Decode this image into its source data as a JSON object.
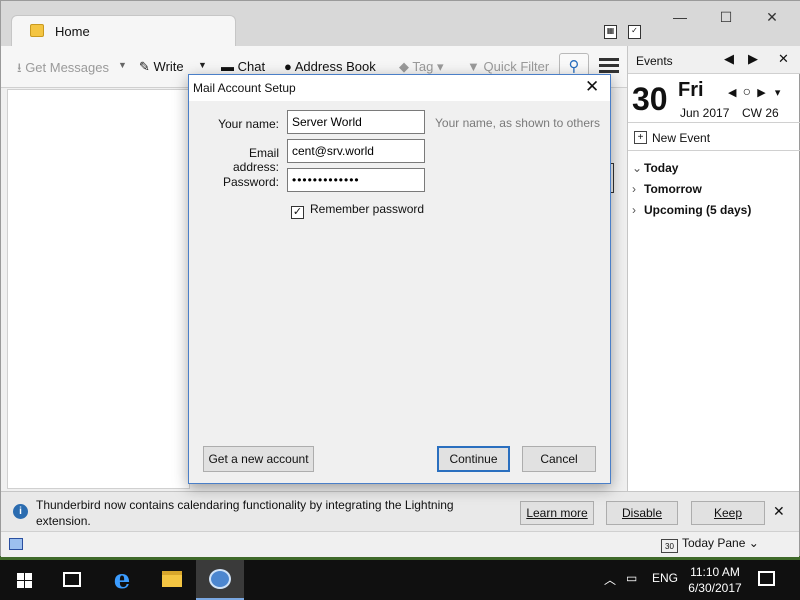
{
  "window": {
    "tab_title": "Home"
  },
  "toolbar": {
    "get_messages": "Get Messages",
    "write": "Write",
    "chat": "Chat",
    "address_book": "Address Book",
    "tag": "Tag",
    "quick_filter": "Quick Filter"
  },
  "events": {
    "title": "Events",
    "day_number": "30",
    "weekday": "Fri",
    "month_year": "Jun 2017",
    "calendar_week": "CW 26",
    "new_event": "New Event",
    "agenda": [
      {
        "label": "Today",
        "expanded": true
      },
      {
        "label": "Tomorrow",
        "expanded": false
      },
      {
        "label": "Upcoming (5 days)",
        "expanded": false
      }
    ]
  },
  "dialog": {
    "title": "Mail Account Setup",
    "name_label": "Your name:",
    "name_value": "Server World",
    "name_hint": "Your name, as shown to others",
    "email_label": "Email address:",
    "email_value": "cent@srv.world",
    "password_label": "Password:",
    "password_value": "•••••••••••••",
    "remember_label": "Remember password",
    "remember_checked": true,
    "get_new_account": "Get a new account",
    "continue": "Continue",
    "cancel": "Cancel"
  },
  "notification": {
    "message": "Thunderbird now contains calendaring functionality by integrating the Lightning extension.",
    "learn_more": "Learn more",
    "disable": "Disable",
    "keep": "Keep"
  },
  "statusbar": {
    "today_pane": "Today Pane",
    "calendar_icon_day": "30"
  },
  "taskbar": {
    "language": "ENG",
    "time": "11:10 AM",
    "date": "6/30/2017"
  },
  "colors": {
    "accent": "#2a6fbf",
    "taskbar": "#101010"
  }
}
